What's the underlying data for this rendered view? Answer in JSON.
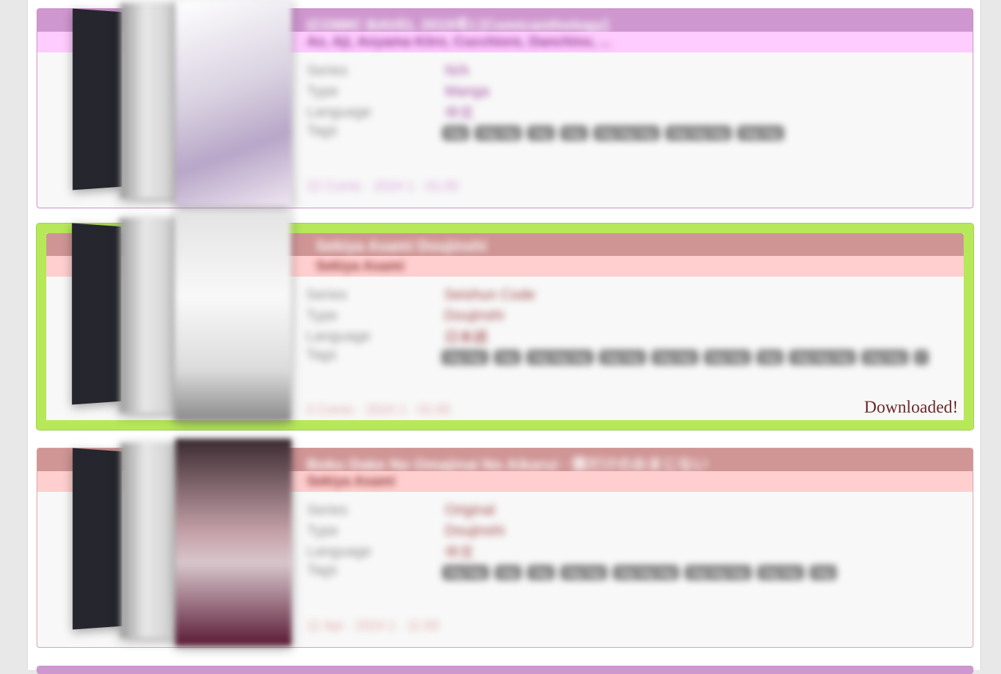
{
  "galleries": [
    {
      "title": "(COMIC BAVEL 2019冬) [Comicanthology]",
      "artists": "Ao, Aji, Aoyama Kiiro, Cucchiore, Danchino, ...",
      "meta": [
        {
          "key": "Series",
          "value": "N/A"
        },
        {
          "key": "Type",
          "value": "Manga"
        },
        {
          "key": "Language",
          "value": "中文"
        }
      ],
      "tags_label": "Tags",
      "tags": [
        "tag",
        "tag tag",
        "tag",
        "tag",
        "tag tag tag",
        "tag tag tag",
        "tag tag"
      ],
      "date": "22 Comic · 2024 1 · 01:00",
      "downloaded": false
    },
    {
      "title": "Sekiya Asami Doujinshi",
      "artists": "Sekiya Asami",
      "meta": [
        {
          "key": "Series",
          "value": "Seishun Code"
        },
        {
          "key": "Type",
          "value": "Doujinshi"
        },
        {
          "key": "Language",
          "value": "日本語"
        }
      ],
      "tags_label": "Tags",
      "tags": [
        "tag tag",
        "tag",
        "tag tag tag",
        "tag tag",
        "tag tag",
        "tag tag",
        "tag",
        "tag tag tag",
        "tag tag",
        "t"
      ],
      "date": "3 Comic · 2024 1 · 01:00",
      "downloaded": true,
      "downloaded_label": "Downloaded!"
    },
    {
      "title": "Boku Dake No Omajinai No Aikarui · 僕だけのおまじない",
      "artists": "Sekiya Asami",
      "meta": [
        {
          "key": "Series",
          "value": "Original"
        },
        {
          "key": "Type",
          "value": "Doujinshi"
        },
        {
          "key": "Language",
          "value": "中文"
        }
      ],
      "tags_label": "Tags",
      "tags": [
        "tag tag",
        "tag",
        "tag",
        "tag tag",
        "tag tag tag",
        "tag tag tag",
        "tag tag",
        "tag"
      ],
      "date": "11 Apr · 2024 1 · 11:00",
      "downloaded": false
    }
  ]
}
